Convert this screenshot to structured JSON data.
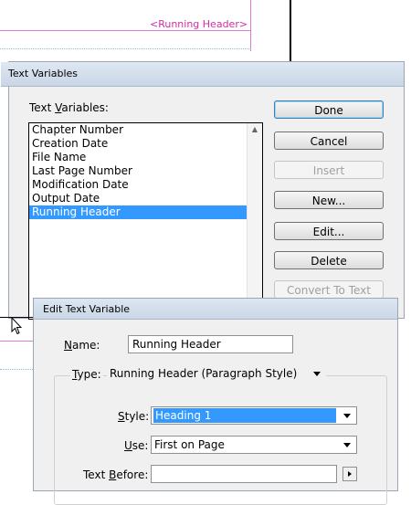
{
  "page": {
    "running_header_tag": "<Running Header>"
  },
  "text_variables_dialog": {
    "title": "Text Variables",
    "list_label_pre": "Text ",
    "list_label_ul": "V",
    "list_label_post": "ariables:",
    "items": [
      {
        "label": "Chapter Number",
        "selected": false
      },
      {
        "label": "Creation Date",
        "selected": false
      },
      {
        "label": "File Name",
        "selected": false
      },
      {
        "label": "Last Page Number",
        "selected": false
      },
      {
        "label": "Modification Date",
        "selected": false
      },
      {
        "label": "Output Date",
        "selected": false
      },
      {
        "label": "Running Header",
        "selected": true
      }
    ],
    "buttons": {
      "done": "Done",
      "cancel": "Cancel",
      "insert": "Insert",
      "new": "New...",
      "edit": "Edit...",
      "delete": "Delete",
      "convert": "Convert To Text"
    }
  },
  "edit_dialog": {
    "title": "Edit Text Variable",
    "name_label_ul": "N",
    "name_label_rest": "ame:",
    "name_value": "Running Header",
    "type_label_ul": "T",
    "type_label_rest": "ype:",
    "type_value": "Running Header (Paragraph Style)",
    "style_label_ul": "S",
    "style_label_rest": "tyle:",
    "style_value": "Heading 1",
    "use_label_ul": "U",
    "use_label_rest": "se:",
    "use_value": "First on Page",
    "text_before_label_pre": "Text ",
    "text_before_label_ul": "B",
    "text_before_label_post": "efore:",
    "text_before_value": ""
  },
  "colors": {
    "selection": "#3399ff",
    "guide_pink": "#e07ad8",
    "tag_color": "#d0309f"
  }
}
